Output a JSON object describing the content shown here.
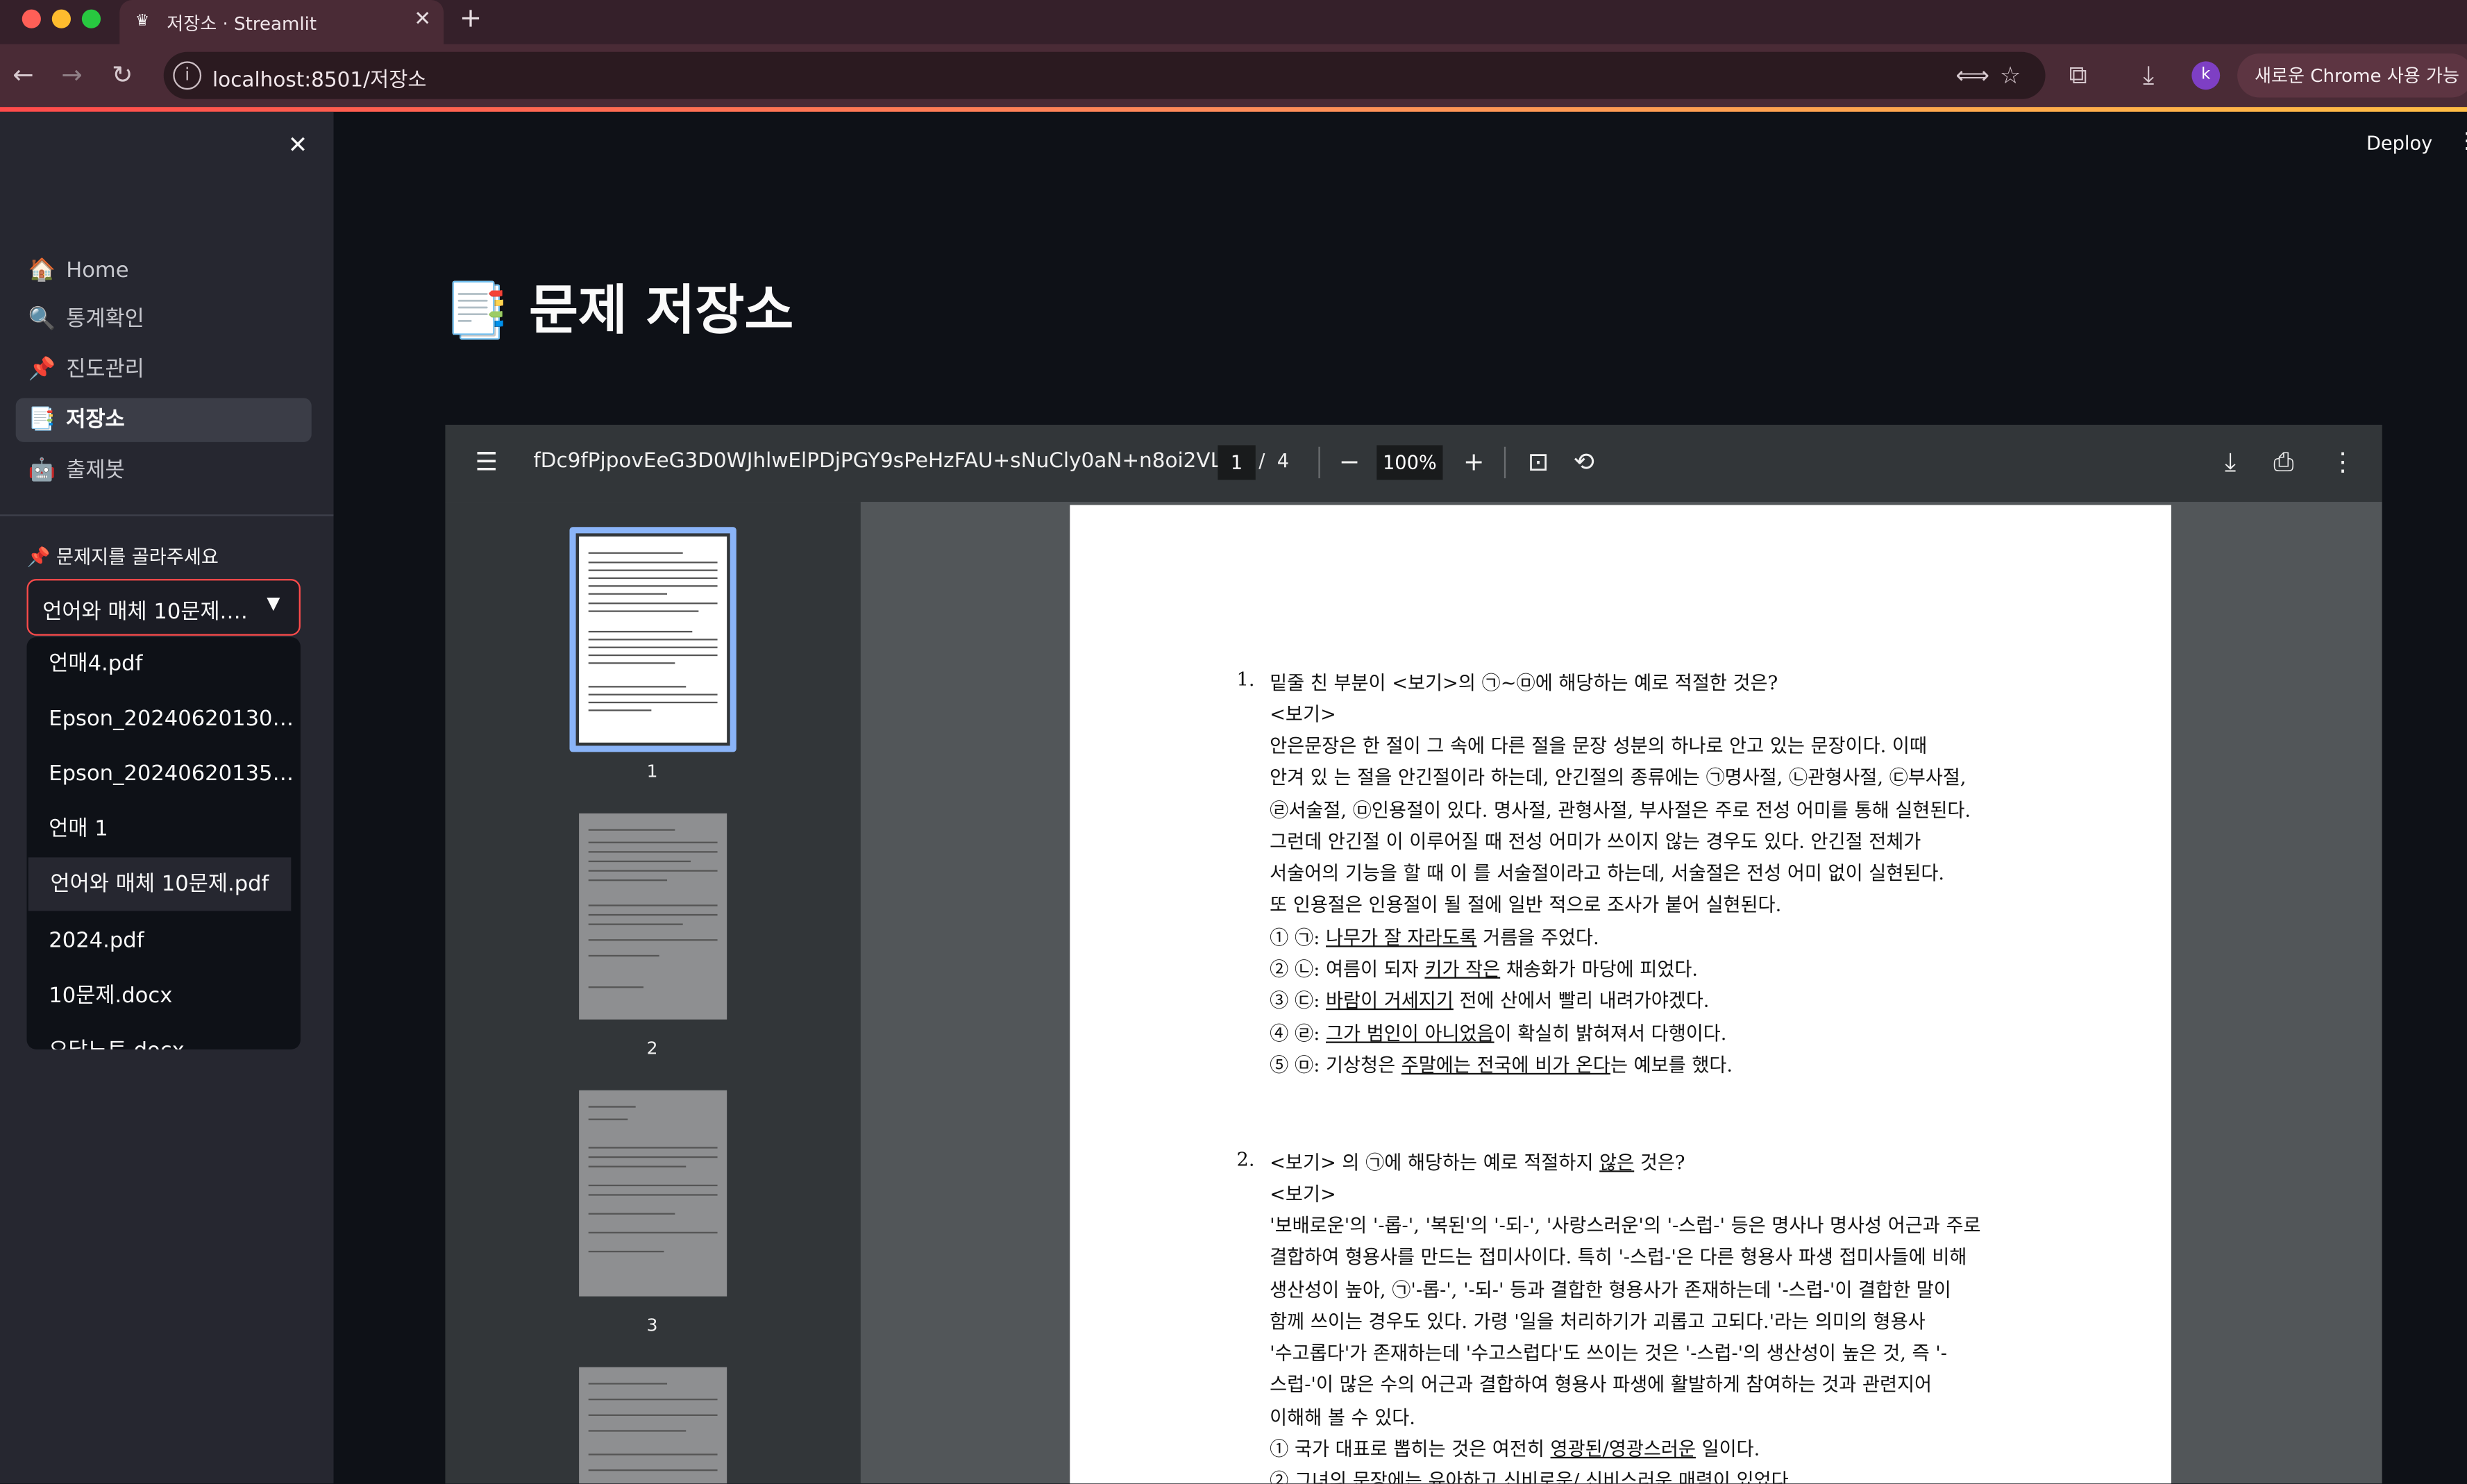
{
  "browser": {
    "tab_title": "저장소 · Streamlit",
    "tab_favicon": "crown-icon",
    "url": "localhost:8501/저장소",
    "avatar_letter": "k",
    "chrome_button": "새로운 Chrome 사용 가능"
  },
  "app": {
    "deploy_label": "Deploy",
    "page_icon": "📑",
    "page_title": "문제 저장소"
  },
  "sidebar": {
    "nav": [
      {
        "icon": "🏠",
        "label": "Home"
      },
      {
        "icon": "🔍",
        "label": "통계확인"
      },
      {
        "icon": "📌",
        "label": "진도관리"
      },
      {
        "icon": "📑",
        "label": "저장소"
      },
      {
        "icon": "🤖",
        "label": "출제봇"
      }
    ],
    "active_index": 3,
    "select_label": "📌 문제지를 골라주세요",
    "select_value": "언어와 매체 10문제.…",
    "options": [
      "언매4.pdf",
      "Epson_20240620130…",
      "Epson_20240620135…",
      "언매 1",
      "언어와 매체 10문제.pdf",
      "2024.pdf",
      "10문제.docx",
      "오답노트.docx"
    ],
    "highlighted_option": "언어와 매체 10문제.pdf"
  },
  "pdf_viewer": {
    "filename": "fDc9fPjpovEeG3D0WJhlwElPDjPGY9sPeHzFAU+sNuCly0aN+n8oi2VL...",
    "current_page": "1",
    "page_separator": "/",
    "total_pages": "4",
    "zoom": "100%",
    "thumbnails": [
      "1",
      "2",
      "3"
    ]
  },
  "document": {
    "q1": {
      "number": "1.",
      "question": "밑줄 친 부분이 <보기>의 ㉠~㉤에 해당하는 예로 적절한 것은?",
      "box_label": "<보기>",
      "passage": [
        "안은문장은 한 절이 그 속에 다른 절을 문장 성분의 하나로 안고 있는 문장이다. 이때",
        "안겨 있 는 절을 안긴절이라 하는데, 안긴절의 종류에는 ㉠명사절, ㉡관형사절, ㉢부사절,",
        "㉣서술절, ㉤인용절이 있다. 명사절, 관형사절, 부사절은 주로 전성 어미를 통해 실현된다.",
        "그런데 안긴절 이 이루어질 때 전성 어미가 쓰이지 않는 경우도 있다. 안긴절 전체가",
        "서술어의 기능을 할 때 이 를 서술절이라고 하는데, 서술절은 전성 어미 없이 실현된다.",
        "또 인용절은 인용절이 될 절에 일반 적으로 조사가 붙어 실현된다."
      ],
      "choices": [
        {
          "prefix": "① ㉠: ",
          "underlined": "나무가 잘 자라도록",
          "suffix": " 거름을 주었다."
        },
        {
          "prefix": "② ㉡: 여름이 되자 ",
          "underlined": "키가 작은",
          "suffix": " 채송화가 마당에 피었다."
        },
        {
          "prefix": "③ ㉢: ",
          "underlined": "바람이 거세지기",
          "suffix": " 전에 산에서 빨리 내려가야겠다."
        },
        {
          "prefix": "④ ㉣: ",
          "underlined": "그가 범인이 아니었음",
          "suffix": "이 확실히 밝혀져서 다행이다."
        },
        {
          "prefix": "⑤ ㉤: 기상청은 ",
          "underlined": "주말에는 전국에 비가 온다",
          "suffix": "는 예보를 했다."
        }
      ]
    },
    "q2": {
      "number": "2.",
      "question_pre": "<보기> 의 ㉠에 해당하는 예로 적절하지 ",
      "question_underlined": "않은",
      "question_post": " 것은?",
      "box_label": "<보기>",
      "passage": [
        "'보배로운'의 '-롭-', '복된'의 '-되-', '사랑스러운'의 '-스럽-' 등은 명사나 명사성 어근과 주로",
        "결합하여 형용사를 만드는 접미사이다. 특히 '-스럽-'은 다른 형용사 파생 접미사들에 비해",
        "생산성이 높아, ㉠'-롭-',  '-되-' 등과 결합한 형용사가 존재하는데 '-스럽-'이 결합한 말이",
        "함께 쓰이는 경우도 있다. 가령 '일을 처리하기가 괴롭고 고되다.'라는 의미의 형용사",
        "'수고롭다'가 존재하는데 '수고스럽다'도 쓰이는 것은 '-스럽-'의 생산성이 높은 것, 즉 '-",
        "스럽-'이 많은 수의 어근과 결합하여 형용사 파생에 활발하게 참여하는 것과 관련지어",
        "이해해 볼 수 있다."
      ],
      "choices": [
        {
          "prefix": "① 국가 대표로 뽑히는 것은 여전히 ",
          "underlined": "영광된/영광스러운",
          "suffix": " 일이다."
        },
        {
          "prefix": "② ",
          "underlined": "그녀의 문장에는 유아하고 신비로운/ 신비스러운 매력이",
          "suffix": " 있었다."
        }
      ]
    }
  }
}
